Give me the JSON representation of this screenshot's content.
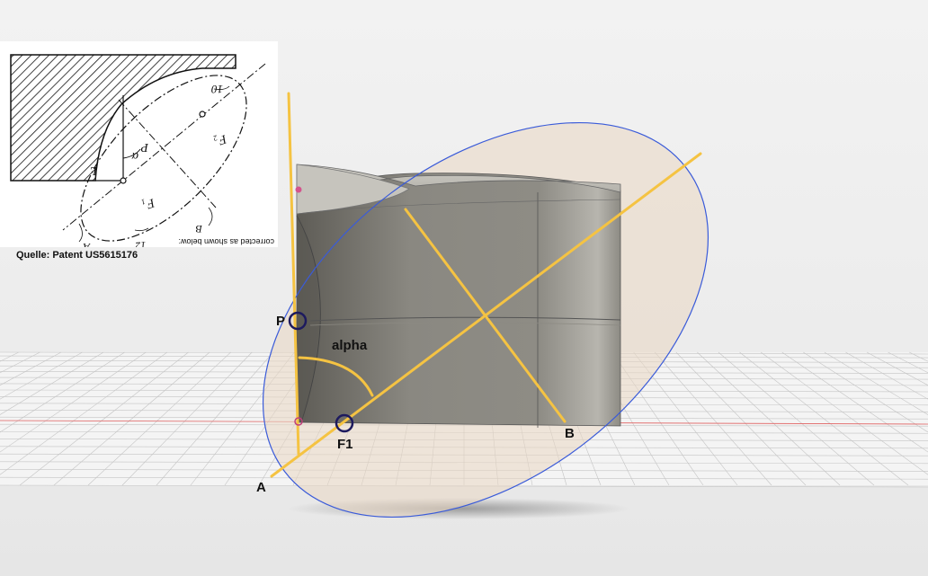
{
  "scene": {
    "labels": {
      "p": "P",
      "alpha": "alpha",
      "f1": "F1",
      "a": "A",
      "b": "B"
    },
    "colors": {
      "construction_lines": "#f5c342",
      "ellipse_outline": "#3a5bd9",
      "ellipse_fill": "#e9d7c2",
      "body": "#7d7b74",
      "point_markers": "#1d1a5e",
      "ground_grid": "#b9b9b9",
      "axis_red": "#e06060"
    }
  },
  "patent_inset": {
    "caption": "Quelle: Patent US5615176",
    "labels": {
      "ref_10": "10",
      "ref_12": "12",
      "ref_f2": "F₂",
      "ref_f1": "F₁",
      "ref_p": "P",
      "ref_l": "L",
      "ref_alpha": "α",
      "ref_a": "A",
      "ref_b": "B",
      "note": "corrected as shown below:"
    }
  }
}
